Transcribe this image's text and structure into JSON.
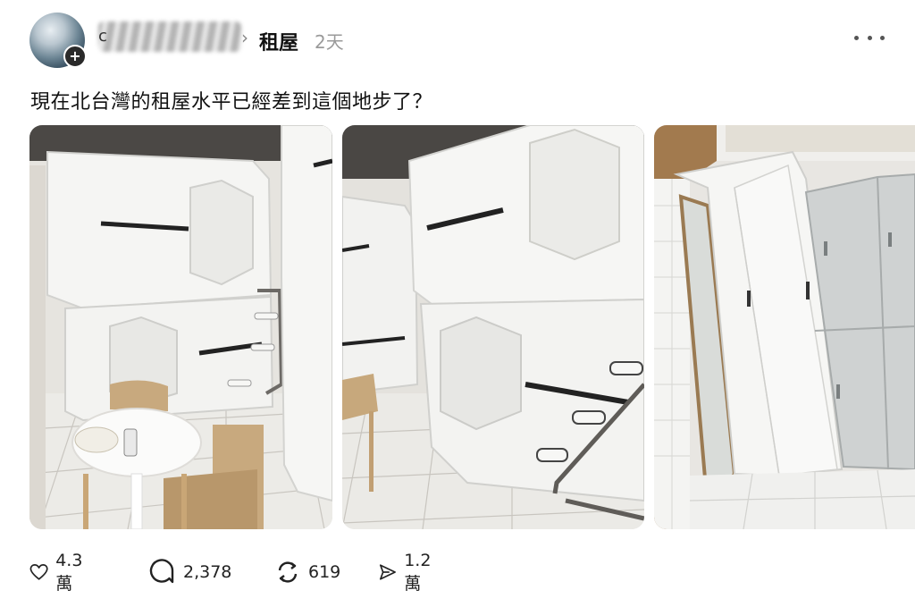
{
  "post": {
    "username_initial": "c",
    "category": "租屋",
    "time": "2天",
    "text": "現在北台灣的租屋水平已經差到這個地步了？"
  },
  "icons": {
    "avatar_badge": "plus-icon",
    "chevron": "chevron-right-icon",
    "more": "more-dots-icon",
    "like": "heart-icon",
    "comment": "comment-icon",
    "repost": "repost-icon",
    "share": "share-icon"
  },
  "stats": {
    "likes": "4.3 萬",
    "comments": "2,378",
    "reposts": "619",
    "shares": "1.2 萬"
  }
}
